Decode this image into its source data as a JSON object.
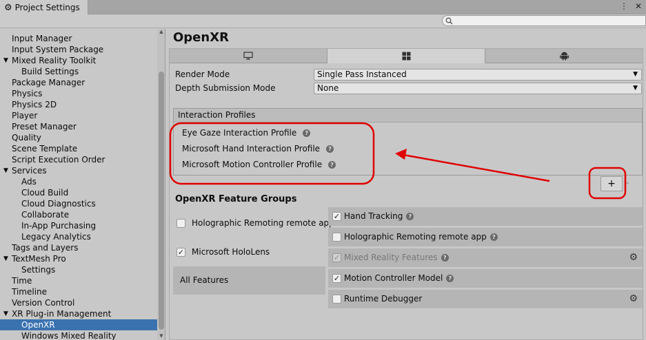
{
  "window": {
    "tab_title": "Project Settings",
    "menu_icon": "kebab-menu-icon",
    "close_icon": "close-icon"
  },
  "search": {
    "placeholder": "",
    "icon": "search-icon"
  },
  "sidebar": {
    "items": [
      {
        "label": "Input Manager",
        "level": 0,
        "expandable": false,
        "selected": false
      },
      {
        "label": "Input System Package",
        "level": 0,
        "expandable": false,
        "selected": false
      },
      {
        "label": "Mixed Reality Toolkit",
        "level": 0,
        "expandable": true,
        "selected": false
      },
      {
        "label": "Build Settings",
        "level": 1,
        "expandable": false,
        "selected": false
      },
      {
        "label": "Package Manager",
        "level": 0,
        "expandable": false,
        "selected": false
      },
      {
        "label": "Physics",
        "level": 0,
        "expandable": false,
        "selected": false
      },
      {
        "label": "Physics 2D",
        "level": 0,
        "expandable": false,
        "selected": false
      },
      {
        "label": "Player",
        "level": 0,
        "expandable": false,
        "selected": false
      },
      {
        "label": "Preset Manager",
        "level": 0,
        "expandable": false,
        "selected": false
      },
      {
        "label": "Quality",
        "level": 0,
        "expandable": false,
        "selected": false
      },
      {
        "label": "Scene Template",
        "level": 0,
        "expandable": false,
        "selected": false
      },
      {
        "label": "Script Execution Order",
        "level": 0,
        "expandable": false,
        "selected": false
      },
      {
        "label": "Services",
        "level": 0,
        "expandable": true,
        "selected": false
      },
      {
        "label": "Ads",
        "level": 1,
        "expandable": false,
        "selected": false
      },
      {
        "label": "Cloud Build",
        "level": 1,
        "expandable": false,
        "selected": false
      },
      {
        "label": "Cloud Diagnostics",
        "level": 1,
        "expandable": false,
        "selected": false
      },
      {
        "label": "Collaborate",
        "level": 1,
        "expandable": false,
        "selected": false
      },
      {
        "label": "In-App Purchasing",
        "level": 1,
        "expandable": false,
        "selected": false
      },
      {
        "label": "Legacy Analytics",
        "level": 1,
        "expandable": false,
        "selected": false
      },
      {
        "label": "Tags and Layers",
        "level": 0,
        "expandable": false,
        "selected": false
      },
      {
        "label": "TextMesh Pro",
        "level": 0,
        "expandable": true,
        "selected": false
      },
      {
        "label": "Settings",
        "level": 1,
        "expandable": false,
        "selected": false
      },
      {
        "label": "Time",
        "level": 0,
        "expandable": false,
        "selected": false
      },
      {
        "label": "Timeline",
        "level": 0,
        "expandable": false,
        "selected": false
      },
      {
        "label": "Version Control",
        "level": 0,
        "expandable": false,
        "selected": false
      },
      {
        "label": "XR Plug-in Management",
        "level": 0,
        "expandable": true,
        "selected": false
      },
      {
        "label": "OpenXR",
        "level": 1,
        "expandable": false,
        "selected": true
      },
      {
        "label": "Windows Mixed Reality",
        "level": 1,
        "expandable": false,
        "selected": false
      }
    ]
  },
  "main": {
    "title": "OpenXR",
    "platform_tabs": [
      {
        "icon": "desktop-icon",
        "active": false
      },
      {
        "icon": "windows-icon",
        "active": true
      },
      {
        "icon": "android-icon",
        "active": false
      }
    ],
    "render_mode": {
      "label": "Render Mode",
      "value": "Single Pass Instanced"
    },
    "depth_mode": {
      "label": "Depth Submission Mode",
      "value": "None"
    },
    "interaction_profiles": {
      "header": "Interaction Profiles",
      "items": [
        "Eye Gaze Interaction Profile",
        "Microsoft Hand Interaction Profile",
        "Microsoft Motion Controller Profile"
      ],
      "add_label": "+",
      "remove_label": "-"
    },
    "feature_groups": {
      "title": "OpenXR Feature Groups",
      "groups": [
        {
          "label": "Holographic Remoting remote app",
          "checked": false
        },
        {
          "label": "Microsoft HoloLens",
          "checked": true
        }
      ],
      "all_features": "All Features"
    },
    "features": [
      {
        "label": "Hand Tracking",
        "checked": true,
        "dim": false,
        "settings": false
      },
      {
        "label": "Holographic Remoting remote app",
        "checked": false,
        "dim": false,
        "settings": false
      },
      {
        "label": "Mixed Reality Features",
        "checked": true,
        "dim": true,
        "settings": true
      },
      {
        "label": "Motion Controller Model",
        "checked": true,
        "dim": false,
        "settings": false
      },
      {
        "label": "Runtime Debugger",
        "checked": false,
        "dim": false,
        "settings": true
      }
    ]
  },
  "colors": {
    "selection": "#3a72b0",
    "annotation": "#e00000"
  }
}
